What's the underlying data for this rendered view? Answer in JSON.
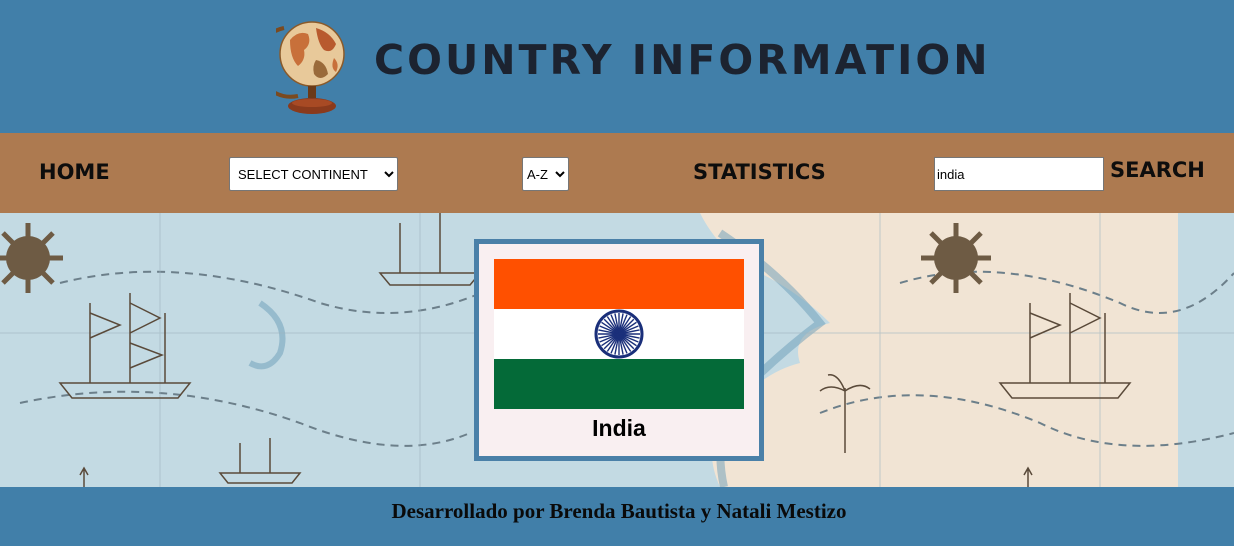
{
  "header": {
    "logo_icon": "globe-icon",
    "title": "COUNTRY INFORMATION"
  },
  "nav": {
    "home_label": "HOME",
    "continent_select": {
      "selected": "SELECT CONTINENT"
    },
    "order_select": {
      "selected": "A-Z"
    },
    "statistics_label": "STATISTICS",
    "search_value": "india",
    "search_label": "SEARCH"
  },
  "country_card": {
    "name": "India",
    "flag_icon": "india-flag",
    "flag_colors": {
      "saffron": "#ff5000",
      "white": "#ffffff",
      "green": "#046a38",
      "chakra": "#1a2f7a"
    }
  },
  "footer": {
    "credit": "Desarrollado por Brenda Bautista y Natali Mestizo"
  },
  "colors": {
    "header_bg": "#417fa9",
    "nav_bg": "#ad7a50",
    "map_bg": "#c3dae3",
    "card_bg": "#f9eff1",
    "card_border": "#4a80a8"
  }
}
